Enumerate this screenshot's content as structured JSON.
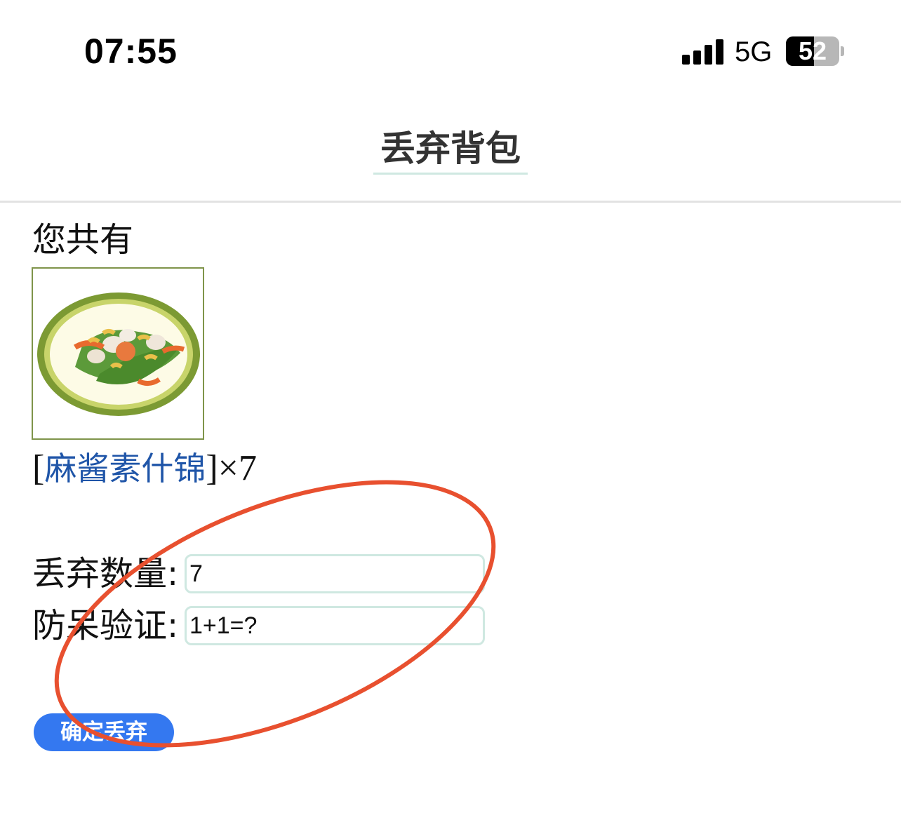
{
  "status_bar": {
    "time": "07:55",
    "network": "5G",
    "battery_level": "52",
    "battery_fraction": 0.52
  },
  "header": {
    "title": "丢弃背包"
  },
  "content": {
    "you_have_label": "您共有",
    "item": {
      "image_alt": "麻酱素什锦",
      "bracket_open": "[",
      "name": "麻酱素什锦",
      "bracket_close": "]",
      "quantity_text": "×7"
    },
    "form": {
      "quantity_label": "丢弃数量:",
      "quantity_value": "7",
      "captcha_label": "防呆验证:",
      "captcha_value": "1+1=?"
    },
    "confirm_button": "确定丢弃"
  },
  "colors": {
    "accent_button": "#3478f0",
    "link": "#1f55a8",
    "input_border": "#cfe8e1",
    "annotation_circle": "#e8502f"
  }
}
